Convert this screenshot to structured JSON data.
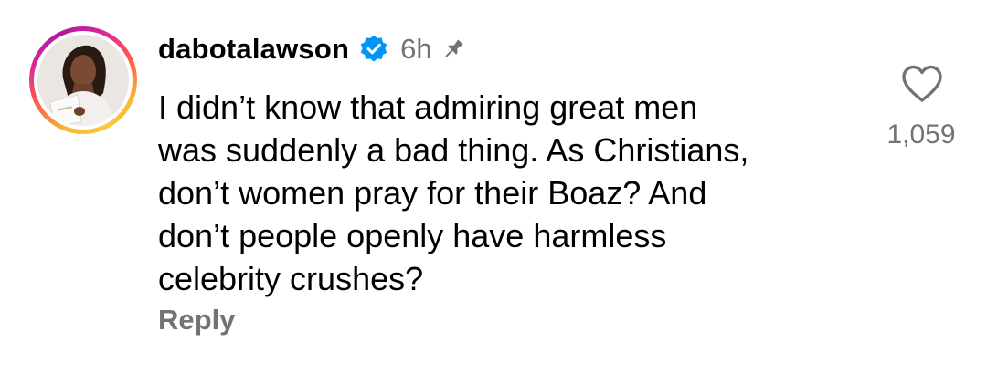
{
  "comment": {
    "username": "dabotalawson",
    "verified": true,
    "timestamp": "6h",
    "pinned": true,
    "text": "I didn’t know that admiring great men\nwas suddenly a bad thing. As Christians,\ndon’t women pray for their Boaz? And\ndon’t people openly have harmless\ncelebrity crushes?",
    "reply_label": "Reply",
    "like_count": "1,059"
  },
  "icons": {
    "verified": "verified-badge-icon",
    "pin": "pin-icon",
    "like": "heart-outline-icon"
  },
  "colors": {
    "text_primary": "#000000",
    "text_secondary": "#737373",
    "verified_blue": "#0095f6",
    "story_ring_start": "#f7b733",
    "story_ring_end": "#d6249f"
  }
}
